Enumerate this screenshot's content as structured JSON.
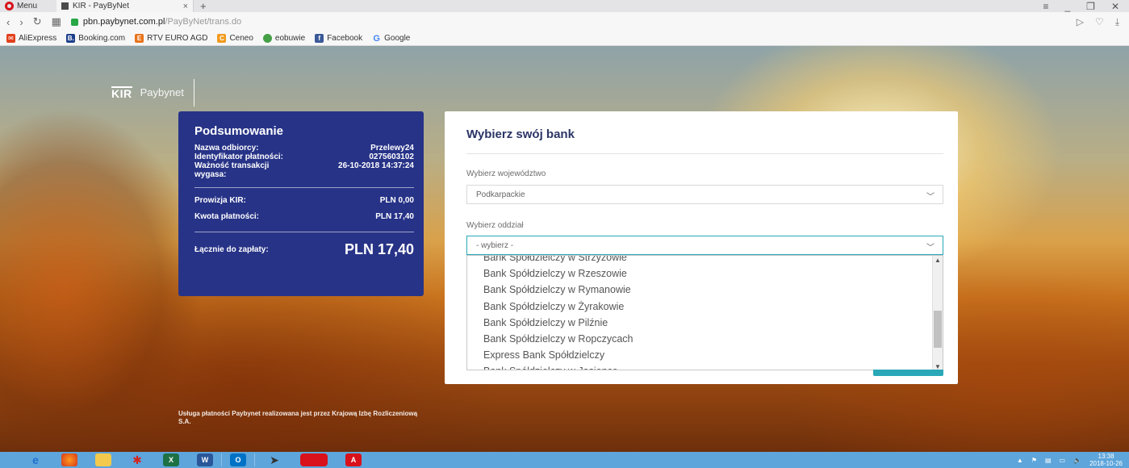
{
  "browser": {
    "menu_label": "Menu",
    "tab_title": "KIR - PayByNet",
    "tab_close": "×",
    "new_tab": "+",
    "url_host": "pbn.paybynet.com.pl",
    "url_path": "/PayByNet/trans.do",
    "bookmarks": [
      "AliExpress",
      "Booking.com",
      "RTV EURO AGD",
      "Ceneo",
      "eobuwie",
      "Facebook",
      "Google"
    ],
    "bookmark_colors": [
      "#e2401c",
      "#1d3f8a",
      "#e8731a",
      "#f29a1d",
      "#45a047",
      "#3b5998",
      "#4285f4"
    ]
  },
  "logo": {
    "kir": "KIR",
    "paybynet": "Paybynet"
  },
  "summary": {
    "title": "Podsumowanie",
    "recipient_label": "Nazwa odbiorcy:",
    "recipient_value": "Przelewy24",
    "payment_id_label": "Identyfikator płatności:",
    "payment_id_value": "0275603102",
    "expiry_label": "Ważność transakcji wygasa:",
    "expiry_value": "26-10-2018 14:37:24",
    "fee_label": "Prowizja KIR:",
    "fee_value": "PLN 0,00",
    "amount_label": "Kwota płatności:",
    "amount_value": "PLN 17,40",
    "total_label": "Łącznie do zapłaty:",
    "total_value": "PLN 17,40"
  },
  "footer_note": "Usługa płatności Paybynet realizowana jest przez Krajową Izbę Rozliczeniową S.A.",
  "bank_form": {
    "title": "Wybierz swój bank",
    "voivodeship_label": "Wybierz województwo",
    "voivodeship_value": "Podkarpackie",
    "branch_label": "Wybierz oddział",
    "branch_value": "- wybierz -",
    "branch_options": [
      "Bank Spółdzielczy w Strzyżowie",
      "Bank Spółdzielczy w Rzeszowie",
      "Bank Spółdzielczy w Rymanowie",
      "Bank Spółdzielczy w Żyrakowie",
      "Bank Spółdzielczy w Pilźnie",
      "Bank Spółdzielczy w Ropczycach",
      "Express Bank Spółdzielczy",
      "Bank Spółdzielczy w Jasionce"
    ]
  },
  "taskbar": {
    "clock_time": "13:38",
    "clock_date": "2018-10-26"
  }
}
